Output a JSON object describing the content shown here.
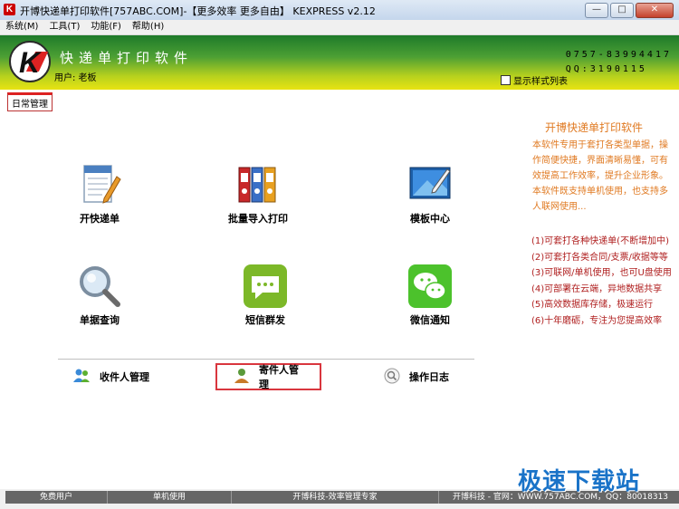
{
  "window": {
    "title": "开博快递单打印软件[757ABC.COM]-【更多效率 更多自由】 KEXPRESS v2.12",
    "controls": [
      "minimize",
      "maximize",
      "close"
    ]
  },
  "menu": [
    "系统(M)",
    "工具(T)",
    "功能(F)",
    "帮助(H)"
  ],
  "banner": {
    "app_name": "快递单打印软件",
    "user_label": "用户: 老板",
    "phone_line": "0757-83994417",
    "qq_line": "QQ:3190115",
    "show_list_label": "显示样式列表"
  },
  "tab": "日常管理",
  "tiles": [
    {
      "label": "开快递单",
      "icon": "form-edit-icon"
    },
    {
      "label": "批量导入打印",
      "icon": "binders-icon"
    },
    {
      "label": "模板中心",
      "icon": "template-board-icon"
    },
    {
      "label": "单据查询",
      "icon": "magnifier-icon"
    },
    {
      "label": "短信群发",
      "icon": "sms-chat-icon"
    },
    {
      "label": "微信通知",
      "icon": "wechat-icon"
    }
  ],
  "managers": [
    {
      "label": "收件人管理",
      "icon": "users-icon"
    },
    {
      "label": "寄件人管理",
      "icon": "user-icon"
    },
    {
      "label": "操作日志",
      "icon": "log-search-icon"
    }
  ],
  "side": {
    "title": "开博快递单打印软件",
    "desc": "本软件专用于套打各类型单据，操作简便快捷，界面清晰易懂，可有效提高工作效率，提升企业形象。本软件既支持单机使用，也支持多人联网使用...",
    "features": [
      "(1)可套打各种快递单(不断增加中)",
      "(2)可套打各类合同/支票/收据等等",
      "(3)可联网/单机使用，也可U盘使用",
      "(4)可部署在云端，异地数据共享",
      "(5)高效数据库存储，极速运行",
      "(6)十年磨砺，专注为您提高效率"
    ]
  },
  "status": [
    "免费用户",
    "单机使用",
    "开博科技-效率管理专家",
    "开博科技 - 官网：WWW.757ABC.COM，QQ：80018313"
  ],
  "watermark": "极速下载站",
  "colors": {
    "accent_red": "#d22222",
    "side_orange": "#e07a22",
    "banner_green": "#3d9a2e",
    "banner_yellow": "#e8e312"
  }
}
